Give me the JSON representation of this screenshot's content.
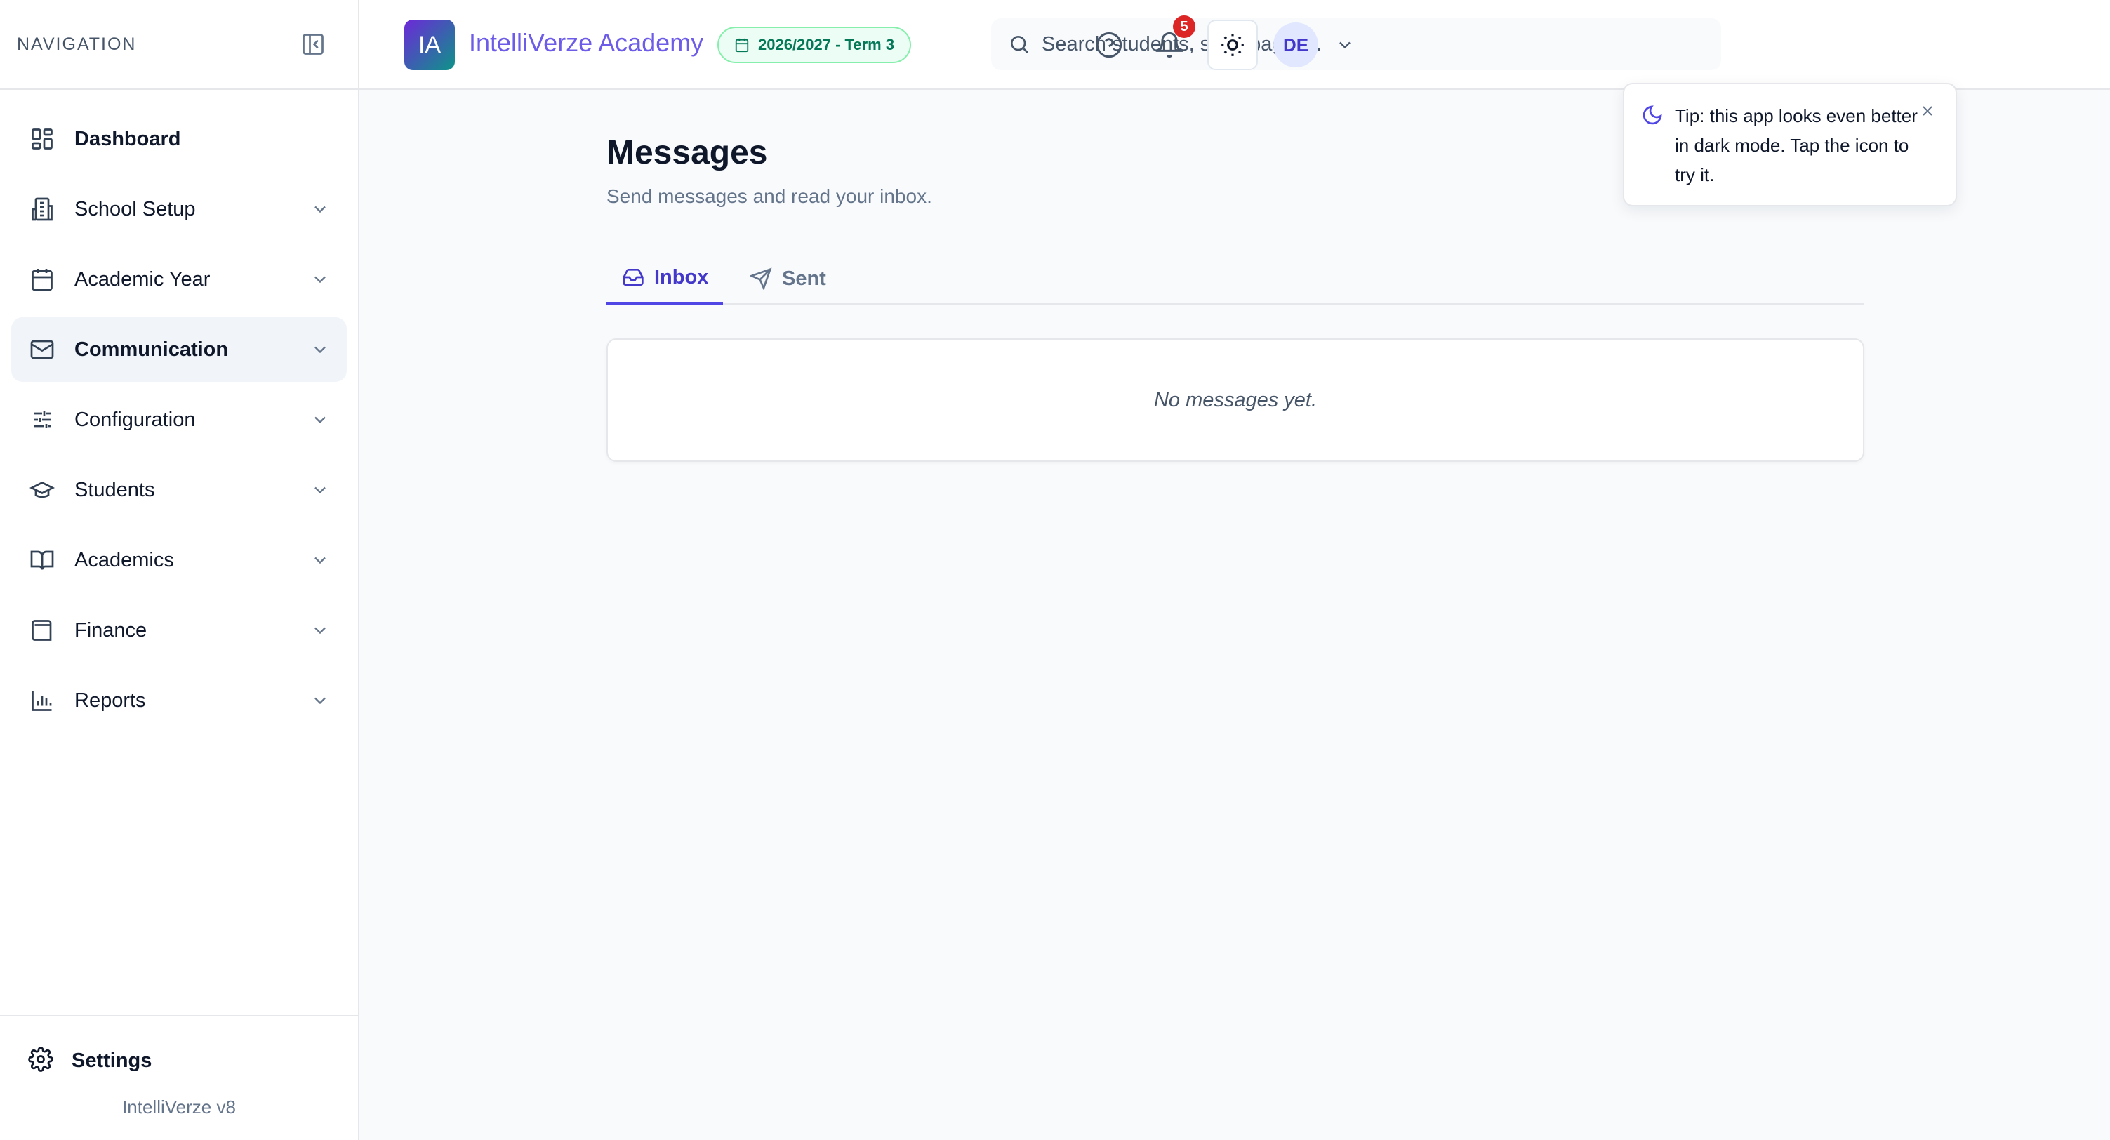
{
  "sidebar": {
    "title": "NAVIGATION",
    "items": [
      {
        "label": "Dashboard",
        "icon": "dashboard-icon"
      },
      {
        "label": "School Setup",
        "icon": "building-icon"
      },
      {
        "label": "Academic Year",
        "icon": "calendar-icon"
      },
      {
        "label": "Communication",
        "icon": "mail-icon",
        "active": true
      },
      {
        "label": "Configuration",
        "icon": "sliders-icon"
      },
      {
        "label": "Students",
        "icon": "graduation-cap-icon"
      },
      {
        "label": "Academics",
        "icon": "book-icon"
      },
      {
        "label": "Finance",
        "icon": "wallet-icon"
      },
      {
        "label": "Reports",
        "icon": "bar-chart-icon"
      }
    ],
    "settings_label": "Settings",
    "version": "IntelliVerze v8"
  },
  "header": {
    "logo_initials": "IA",
    "app_name": "IntelliVerze Academy",
    "term": "2026/2027 - Term 3",
    "search_placeholder": "Search students, staff, pages...",
    "notification_count": "5",
    "avatar_initials": "DE"
  },
  "tip": {
    "text": "Tip: this app looks even better in dark mode. Tap the icon to try it."
  },
  "main": {
    "title": "Messages",
    "subtitle": "Send messages and read your inbox.",
    "tabs": [
      {
        "label": "Inbox",
        "active": true
      },
      {
        "label": "Sent",
        "active": false
      }
    ],
    "empty_text": "No messages yet."
  },
  "colors": {
    "accent": "#4f46e5",
    "badge_red": "#dc2626",
    "term_green": "#047857"
  }
}
